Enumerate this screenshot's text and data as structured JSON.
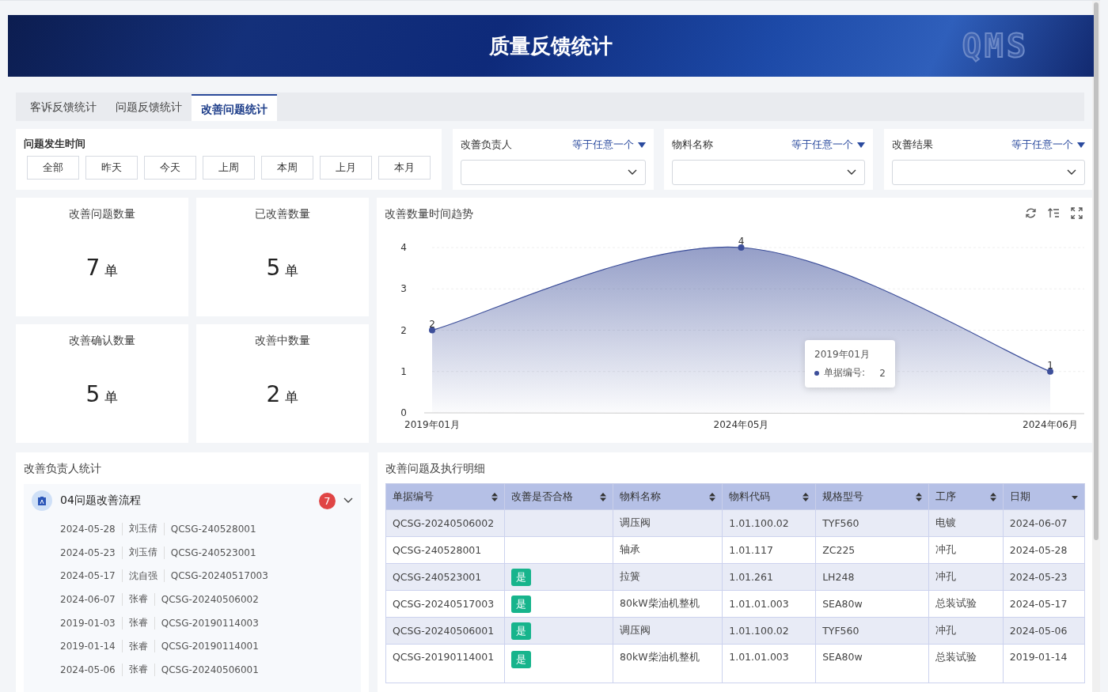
{
  "header": {
    "title": "质量反馈统计",
    "logo": "QMS"
  },
  "tabs": [
    {
      "label": "客诉反馈统计",
      "selected": false
    },
    {
      "label": "问题反馈统计",
      "selected": false
    },
    {
      "label": "改善问题统计",
      "selected": true
    }
  ],
  "date_filter": {
    "label": "问题发生时间",
    "buttons": [
      "全部",
      "昨天",
      "今天",
      "上周",
      "本周",
      "上月",
      "本月"
    ]
  },
  "filters": [
    {
      "label": "改善负责人",
      "operator": "等于任意一个"
    },
    {
      "label": "物料名称",
      "operator": "等于任意一个"
    },
    {
      "label": "改善结果",
      "operator": "等于任意一个"
    }
  ],
  "stats": [
    {
      "label": "改善问题数量",
      "value": "7",
      "unit": "单"
    },
    {
      "label": "已改善数量",
      "value": "5",
      "unit": "单"
    },
    {
      "label": "改善确认数量",
      "value": "5",
      "unit": "单"
    },
    {
      "label": "改善中数量",
      "value": "2",
      "unit": "单"
    }
  ],
  "trend": {
    "title": "改善数量时间趋势",
    "chart_data": {
      "type": "area",
      "categories": [
        "2019年01月",
        "2024年05月",
        "2024年06月"
      ],
      "series": [
        {
          "color": "#3d4f9a",
          "values": [
            2,
            4,
            1
          ]
        }
      ],
      "ylim": [
        0,
        4
      ],
      "yticks": [
        0,
        1,
        2,
        3,
        4
      ],
      "data_labels": true,
      "grid": true
    },
    "tooltip": {
      "title": "2019年01月",
      "series_name": "单据编号:",
      "value": "2"
    }
  },
  "owners": {
    "title": "改善负责人统计",
    "group": {
      "name": "04问题改善流程",
      "count": "7",
      "expanded": true,
      "items": [
        {
          "date": "2024-05-28",
          "person": "刘玉倩",
          "code": "QCSG-240528001"
        },
        {
          "date": "2024-05-23",
          "person": "刘玉倩",
          "code": "QCSG-240523001"
        },
        {
          "date": "2024-05-17",
          "person": "沈自强",
          "code": "QCSG-20240517003"
        },
        {
          "date": "2024-06-07",
          "person": "张睿",
          "code": "QCSG-20240506002"
        },
        {
          "date": "2019-01-03",
          "person": "张睿",
          "code": "QCSG-20190114003"
        },
        {
          "date": "2019-01-14",
          "person": "张睿",
          "code": "QCSG-20190114001"
        },
        {
          "date": "2024-05-06",
          "person": "张睿",
          "code": "QCSG-20240506001"
        }
      ]
    }
  },
  "details": {
    "title": "改善问题及执行明细",
    "columns": [
      {
        "label": "单据编号",
        "sorted": false
      },
      {
        "label": "改善是否合格",
        "sorted": false
      },
      {
        "label": "物料名称",
        "sorted": false
      },
      {
        "label": "物料代码",
        "sorted": false
      },
      {
        "label": "规格型号",
        "sorted": false
      },
      {
        "label": "工序",
        "sorted": false
      },
      {
        "label": "日期",
        "sorted": true
      }
    ],
    "rows": [
      {
        "code": "QCSG-20240506002",
        "material": "调压阀",
        "material_code": "1.01.100.02",
        "spec": "TYF560",
        "process": "电镀",
        "date": "2024-06-07"
      },
      {
        "code": "QCSG-240528001",
        "material": "轴承",
        "material_code": "1.01.117",
        "spec": "ZC225",
        "process": "冲孔",
        "date": "2024-05-28"
      },
      {
        "code": "QCSG-240523001",
        "qualified": "是",
        "material": "拉簧",
        "material_code": "1.01.261",
        "spec": "LH248",
        "process": "冲孔",
        "date": "2024-05-23"
      },
      {
        "code": "QCSG-20240517003",
        "qualified": "是",
        "material": "80kW柴油机整机",
        "material_code": "1.01.01.003",
        "spec": "SEA80w",
        "process": "总装试验",
        "date": "2024-05-17"
      },
      {
        "code": "QCSG-20240506001",
        "qualified": "是",
        "material": "调压阀",
        "material_code": "1.01.100.02",
        "spec": "TYF560",
        "process": "冲孔",
        "date": "2024-05-06"
      },
      {
        "code": "QCSG-20190114001",
        "qualified": "是",
        "material": "80kW柴油机整机",
        "material_code": "1.01.01.003",
        "spec": "SEA80w",
        "process": "总装试验",
        "date": "2019-01-14"
      }
    ]
  }
}
